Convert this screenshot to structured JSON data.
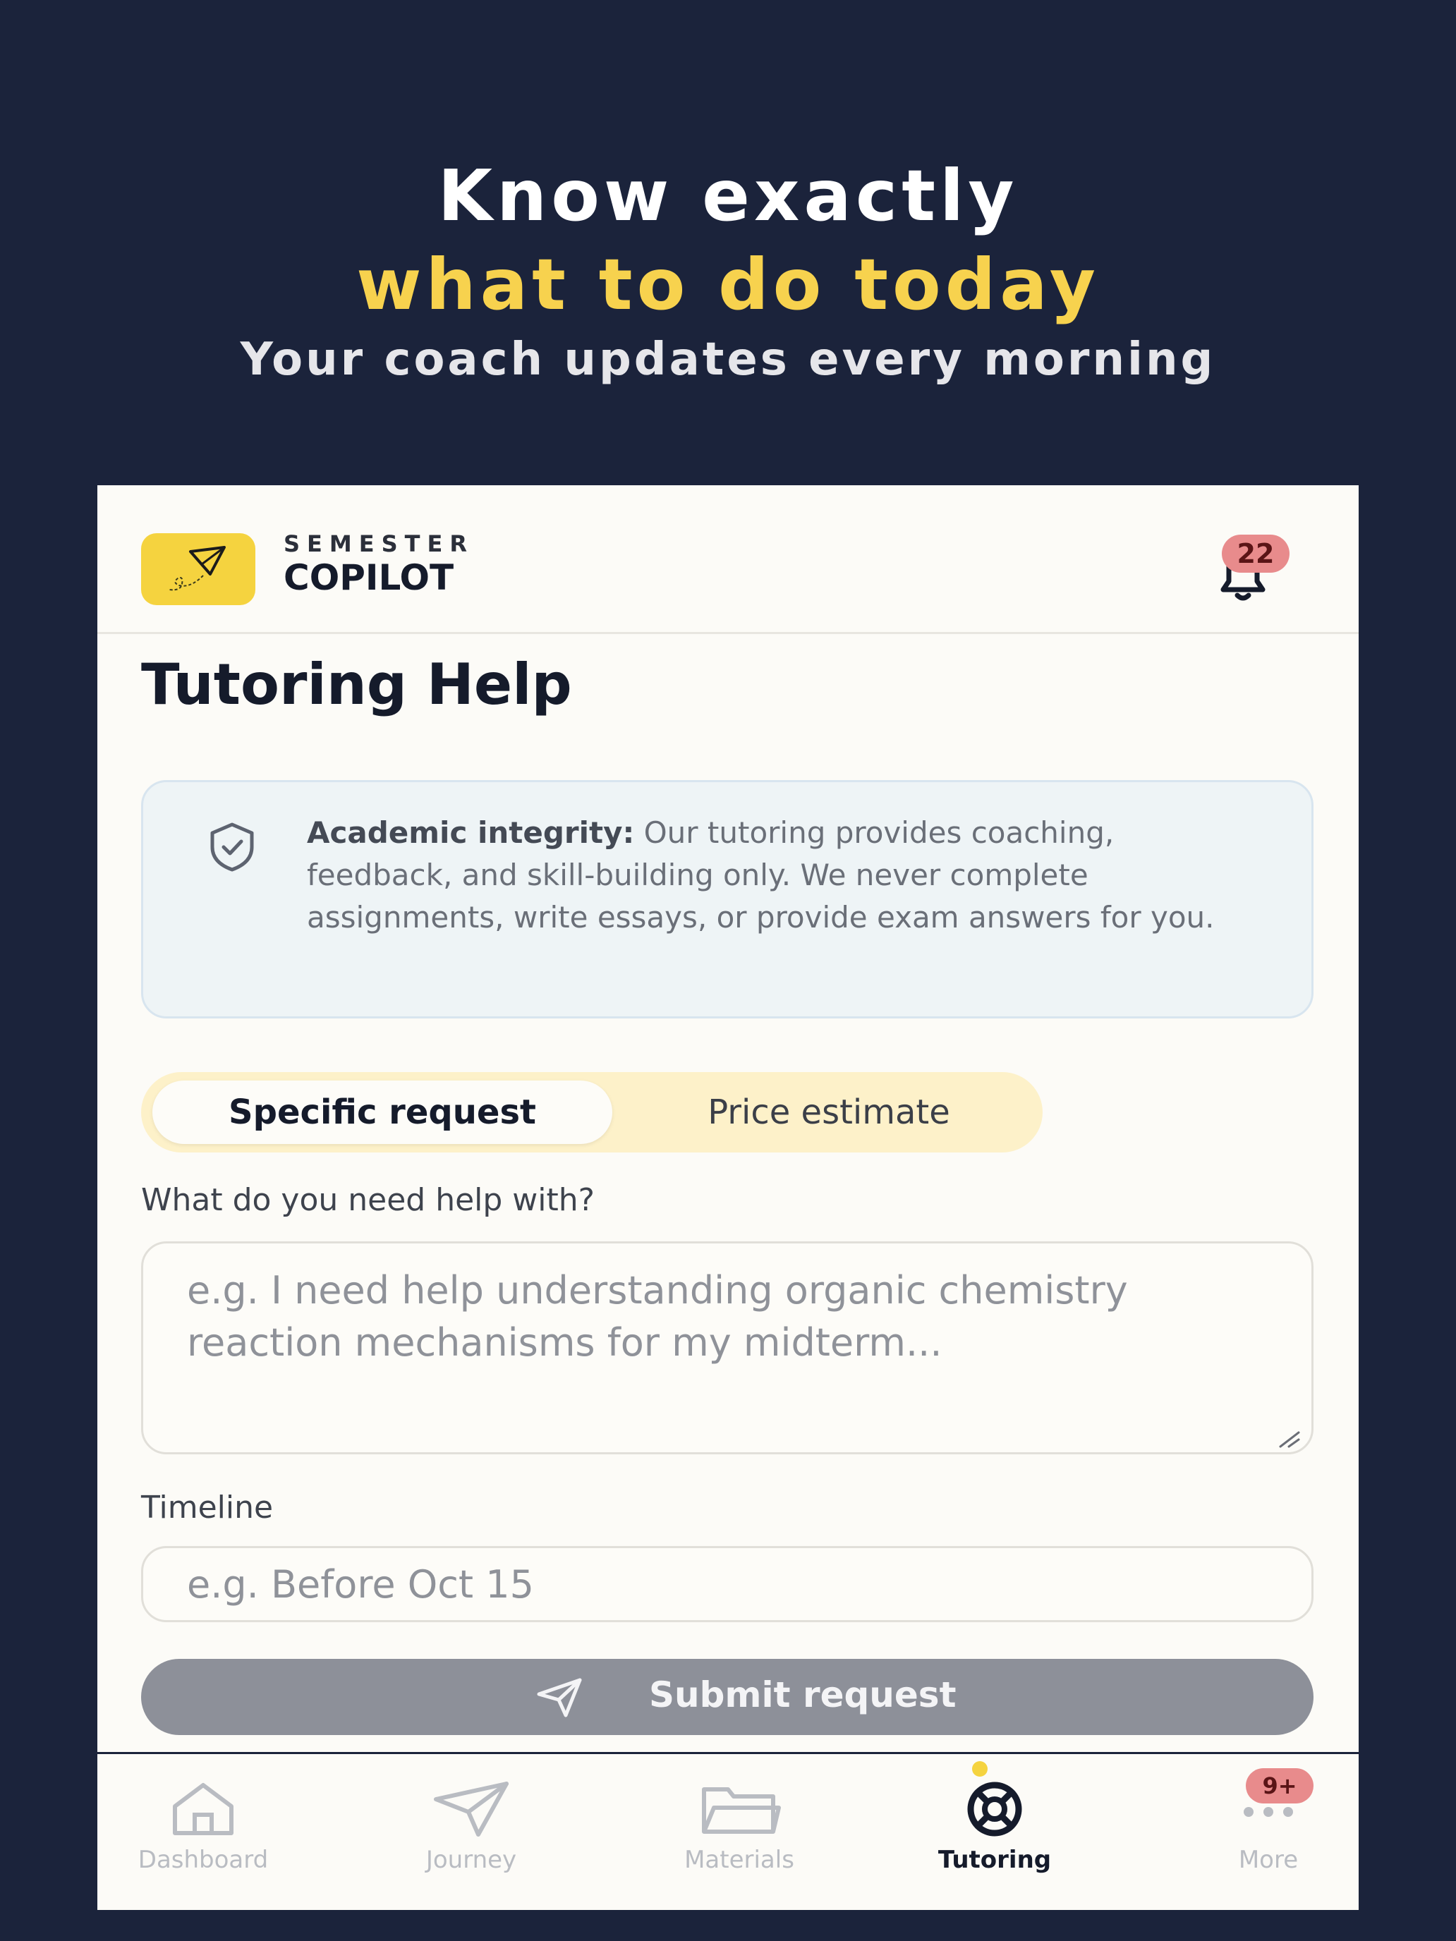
{
  "hero": {
    "line1": "Know exactly",
    "line2": "what to do today",
    "line3": "Your coach updates every morning"
  },
  "header": {
    "brand_top": "SEMESTER",
    "brand_main": "COPILOT",
    "notification_count": "22"
  },
  "page": {
    "title": "Tutoring Help"
  },
  "notice": {
    "lead": "Academic integrity:",
    "body": " Our tutoring provides coaching, feedback, and skill-building only. We never complete assignments, write essays, or provide exam answers for you."
  },
  "tabs": [
    {
      "label": "Specific request",
      "active": true
    },
    {
      "label": "Price estimate",
      "active": false
    }
  ],
  "form": {
    "help_label": "What do you need help with?",
    "help_placeholder": "e.g. I need help understanding organic chemistry reaction mechanisms for my midterm...",
    "timeline_label": "Timeline",
    "timeline_placeholder": "e.g. Before Oct 15",
    "submit_label": "Submit request"
  },
  "nav": {
    "items": [
      {
        "label": "Dashboard",
        "icon": "home-icon"
      },
      {
        "label": "Journey",
        "icon": "paper-plane-icon"
      },
      {
        "label": "Materials",
        "icon": "folder-icon"
      },
      {
        "label": "Tutoring",
        "icon": "lifebuoy-icon",
        "active": true
      },
      {
        "label": "More",
        "icon": "more-icon"
      }
    ],
    "more_badge": "9+"
  },
  "colors": {
    "background": "#1b233b",
    "accent": "#f7d24e",
    "badge": "#e88b8c",
    "button_disabled": "#8d9099"
  }
}
